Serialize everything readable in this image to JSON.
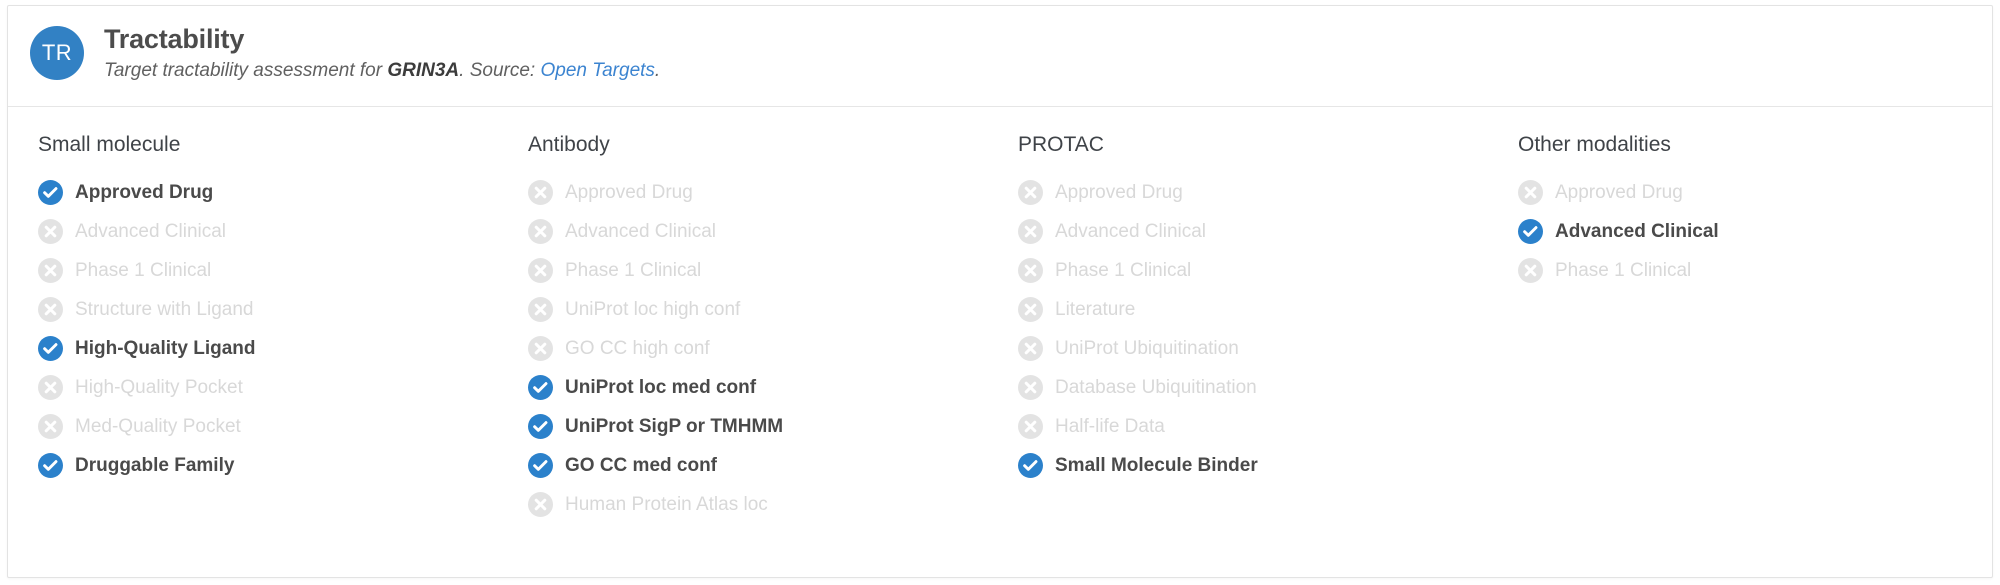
{
  "header": {
    "avatar_initials": "TR",
    "avatar_color": "#3281c4",
    "title": "Tractability",
    "subtitle_prefix": "Target tractability assessment for ",
    "subtitle_target": "GRIN3A",
    "subtitle_mid": ". Source: ",
    "subtitle_link": "Open Targets",
    "subtitle_suffix": ".",
    "link_color": "#3c84d0"
  },
  "icons": {
    "check": "check-circle-icon",
    "cross": "x-circle-icon",
    "active_color": "#2b81cb",
    "inactive_color": "#e3e3e3"
  },
  "columns": [
    {
      "title": "Small molecule",
      "items": [
        {
          "label": "Approved Drug",
          "active": true
        },
        {
          "label": "Advanced Clinical",
          "active": false
        },
        {
          "label": "Phase 1 Clinical",
          "active": false
        },
        {
          "label": "Structure with Ligand",
          "active": false
        },
        {
          "label": "High-Quality Ligand",
          "active": true
        },
        {
          "label": "High-Quality Pocket",
          "active": false
        },
        {
          "label": "Med-Quality Pocket",
          "active": false
        },
        {
          "label": "Druggable Family",
          "active": true
        }
      ]
    },
    {
      "title": "Antibody",
      "items": [
        {
          "label": "Approved Drug",
          "active": false
        },
        {
          "label": "Advanced Clinical",
          "active": false
        },
        {
          "label": "Phase 1 Clinical",
          "active": false
        },
        {
          "label": "UniProt loc high conf",
          "active": false
        },
        {
          "label": "GO CC high conf",
          "active": false
        },
        {
          "label": "UniProt loc med conf",
          "active": true
        },
        {
          "label": "UniProt SigP or TMHMM",
          "active": true
        },
        {
          "label": "GO CC med conf",
          "active": true
        },
        {
          "label": "Human Protein Atlas loc",
          "active": false
        }
      ]
    },
    {
      "title": "PROTAC",
      "items": [
        {
          "label": "Approved Drug",
          "active": false
        },
        {
          "label": "Advanced Clinical",
          "active": false
        },
        {
          "label": "Phase 1 Clinical",
          "active": false
        },
        {
          "label": "Literature",
          "active": false
        },
        {
          "label": "UniProt Ubiquitination",
          "active": false
        },
        {
          "label": "Database Ubiquitination",
          "active": false
        },
        {
          "label": "Half-life Data",
          "active": false
        },
        {
          "label": "Small Molecule Binder",
          "active": true
        }
      ]
    },
    {
      "title": "Other modalities",
      "items": [
        {
          "label": "Approved Drug",
          "active": false
        },
        {
          "label": "Advanced Clinical",
          "active": true
        },
        {
          "label": "Phase 1 Clinical",
          "active": false
        }
      ]
    }
  ]
}
